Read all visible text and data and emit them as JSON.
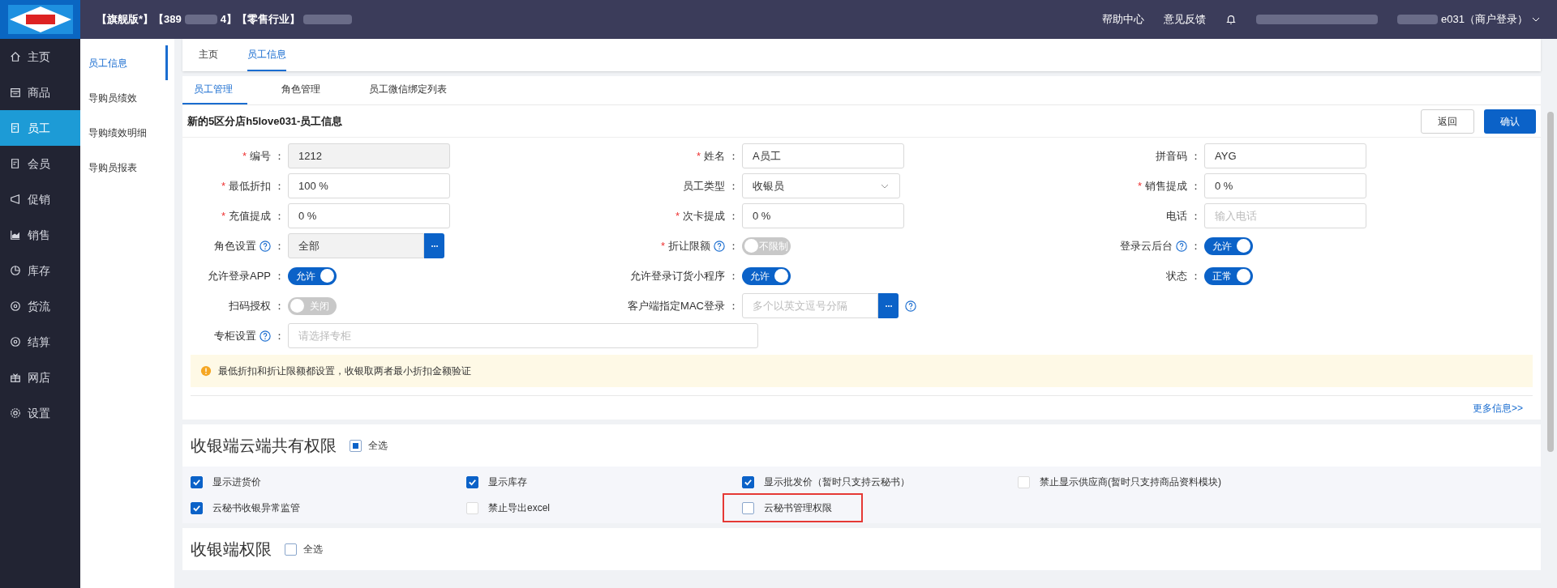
{
  "header": {
    "edition": "【旗舰版*】【389",
    "edition_tail": "4】【零售行业】",
    "links": [
      "帮助中心",
      "意见反馈"
    ],
    "user": "e031（商户登录）"
  },
  "sidebar": {
    "items": [
      {
        "label": "主页",
        "selected": false
      },
      {
        "label": "商品",
        "selected": false
      },
      {
        "label": "员工",
        "selected": true
      },
      {
        "label": "会员",
        "selected": false
      },
      {
        "label": "促销",
        "selected": false
      },
      {
        "label": "销售",
        "selected": false
      },
      {
        "label": "库存",
        "selected": false
      },
      {
        "label": "货流",
        "selected": false
      },
      {
        "label": "结算",
        "selected": false
      },
      {
        "label": "网店",
        "selected": false
      },
      {
        "label": "设置",
        "selected": false
      }
    ]
  },
  "submenu": {
    "items": [
      {
        "label": "员工信息",
        "selected": true
      },
      {
        "label": "导购员绩效",
        "selected": false
      },
      {
        "label": "导购绩效明细",
        "selected": false
      },
      {
        "label": "导购员报表",
        "selected": false
      }
    ]
  },
  "page_tabs": [
    {
      "label": "主页",
      "selected": false
    },
    {
      "label": "员工信息",
      "selected": true
    }
  ],
  "sub_tabs": [
    {
      "label": "员工管理",
      "selected": true
    },
    {
      "label": "角色管理",
      "selected": false
    },
    {
      "label": "员工微信绑定列表",
      "selected": false
    }
  ],
  "title": "新的5区分店h5love031-员工信息",
  "actions": {
    "back": "返回",
    "confirm": "确认"
  },
  "form_rows": [
    [
      {
        "kind": "text",
        "required_mark": "*",
        "label": "编号",
        "colon": "：",
        "value": "1212",
        "disabled": true
      },
      {
        "kind": "text",
        "required_mark": "*",
        "label": "姓名",
        "colon": "：",
        "value": "A员工",
        "disabled": false
      },
      {
        "kind": "text",
        "label": "拼音码",
        "colon": "：",
        "value": "AYG",
        "disabled": false
      }
    ],
    [
      {
        "kind": "text",
        "required_mark": "*",
        "label": "最低折扣",
        "colon": "：",
        "value": "100 %",
        "disabled": false
      },
      {
        "kind": "select",
        "label": "员工类型",
        "colon": "：",
        "value": "收银员",
        "disabled": false
      },
      {
        "kind": "text",
        "required_mark": "*",
        "label": "销售提成",
        "colon": "：",
        "value": "0 %",
        "disabled": false
      }
    ],
    [
      {
        "kind": "text",
        "required_mark": "*",
        "label": "充值提成",
        "colon": "：",
        "value": "0 %",
        "disabled": false
      },
      {
        "kind": "text",
        "required_mark": "*",
        "label": "次卡提成",
        "colon": "：",
        "value": "0 %",
        "disabled": false
      },
      {
        "kind": "text",
        "label": "电话",
        "colon": "：",
        "placeholder": "输入电话",
        "disabled": false
      }
    ],
    [
      {
        "kind": "picker",
        "label": "角色设置",
        "help": true,
        "colon": "：",
        "value": "全部",
        "disabled": true
      },
      {
        "kind": "toggle",
        "required_mark": "*",
        "label": "折让限额",
        "help": true,
        "colon": "：",
        "on": false,
        "text": "不限制"
      },
      {
        "kind": "toggle",
        "label": "登录云后台",
        "help": true,
        "colon": "：",
        "on": true,
        "text": "允许"
      }
    ],
    [
      {
        "kind": "toggle",
        "label": "允许登录APP",
        "colon": "：",
        "on": true,
        "text": "允许"
      },
      {
        "kind": "toggle",
        "label": "允许登录订货小程序",
        "colon": "：",
        "on": true,
        "text": "允许"
      },
      {
        "kind": "toggle",
        "label": "状态",
        "colon": "：",
        "on": true,
        "text": "正常"
      }
    ],
    [
      {
        "kind": "toggle",
        "label": "扫码授权",
        "colon": "：",
        "on": false,
        "text": "关闭"
      },
      {
        "kind": "picker_help",
        "label": "客户端指定MAC登录",
        "colon": "：",
        "placeholder": "多个以英文逗号分隔",
        "disabled": false
      }
    ],
    [
      {
        "kind": "wide",
        "label": "专柜设置",
        "help": true,
        "colon": "：",
        "placeholder": "请选择专柜",
        "disabled": false
      }
    ]
  ],
  "notice": "最低折扣和折让限额都设置，收银取两者最小折扣金额验证",
  "more_link": "更多信息>>",
  "sections": [
    {
      "title": "收银端云端共有权限",
      "select_all": {
        "label": "全选",
        "indeterminate": true
      },
      "items": [
        {
          "label": "显示进货价",
          "checked": true,
          "disabled": false,
          "highlighted": false
        },
        {
          "label": "显示库存",
          "checked": true,
          "disabled": false,
          "highlighted": false
        },
        {
          "label": "显示批发价（暂时只支持云秘书）",
          "checked": true,
          "disabled": false,
          "highlighted": false
        },
        {
          "label": "禁止显示供应商(暂时只支持商品资料模块)",
          "checked": false,
          "disabled": true,
          "highlighted": false
        },
        {
          "label": "云秘书收银异常监管",
          "checked": true,
          "disabled": false,
          "highlighted": false
        },
        {
          "label": "禁止导出excel",
          "checked": false,
          "disabled": true,
          "highlighted": false
        },
        {
          "label": "云秘书管理权限",
          "checked": false,
          "disabled": false,
          "highlighted": true
        }
      ]
    },
    {
      "title": "收银端权限",
      "select_all": {
        "label": "全选",
        "checked": false,
        "indeterminate": false
      }
    }
  ]
}
